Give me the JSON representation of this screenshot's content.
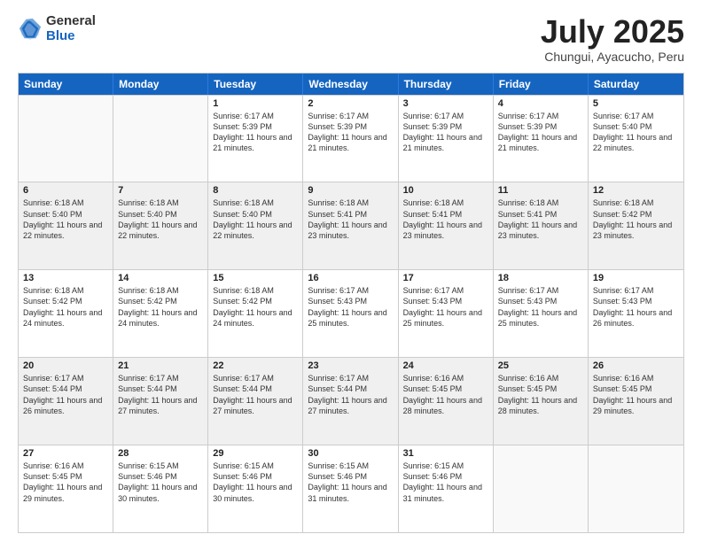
{
  "header": {
    "logo_general": "General",
    "logo_blue": "Blue",
    "month": "July 2025",
    "location": "Chungui, Ayacucho, Peru"
  },
  "days_of_week": [
    "Sunday",
    "Monday",
    "Tuesday",
    "Wednesday",
    "Thursday",
    "Friday",
    "Saturday"
  ],
  "weeks": [
    [
      {
        "day": "",
        "sunrise": "",
        "sunset": "",
        "daylight": "",
        "empty": true
      },
      {
        "day": "",
        "sunrise": "",
        "sunset": "",
        "daylight": "",
        "empty": true
      },
      {
        "day": "1",
        "sunrise": "Sunrise: 6:17 AM",
        "sunset": "Sunset: 5:39 PM",
        "daylight": "Daylight: 11 hours and 21 minutes.",
        "empty": false
      },
      {
        "day": "2",
        "sunrise": "Sunrise: 6:17 AM",
        "sunset": "Sunset: 5:39 PM",
        "daylight": "Daylight: 11 hours and 21 minutes.",
        "empty": false
      },
      {
        "day": "3",
        "sunrise": "Sunrise: 6:17 AM",
        "sunset": "Sunset: 5:39 PM",
        "daylight": "Daylight: 11 hours and 21 minutes.",
        "empty": false
      },
      {
        "day": "4",
        "sunrise": "Sunrise: 6:17 AM",
        "sunset": "Sunset: 5:39 PM",
        "daylight": "Daylight: 11 hours and 21 minutes.",
        "empty": false
      },
      {
        "day": "5",
        "sunrise": "Sunrise: 6:17 AM",
        "sunset": "Sunset: 5:40 PM",
        "daylight": "Daylight: 11 hours and 22 minutes.",
        "empty": false
      }
    ],
    [
      {
        "day": "6",
        "sunrise": "Sunrise: 6:18 AM",
        "sunset": "Sunset: 5:40 PM",
        "daylight": "Daylight: 11 hours and 22 minutes.",
        "empty": false
      },
      {
        "day": "7",
        "sunrise": "Sunrise: 6:18 AM",
        "sunset": "Sunset: 5:40 PM",
        "daylight": "Daylight: 11 hours and 22 minutes.",
        "empty": false
      },
      {
        "day": "8",
        "sunrise": "Sunrise: 6:18 AM",
        "sunset": "Sunset: 5:40 PM",
        "daylight": "Daylight: 11 hours and 22 minutes.",
        "empty": false
      },
      {
        "day": "9",
        "sunrise": "Sunrise: 6:18 AM",
        "sunset": "Sunset: 5:41 PM",
        "daylight": "Daylight: 11 hours and 23 minutes.",
        "empty": false
      },
      {
        "day": "10",
        "sunrise": "Sunrise: 6:18 AM",
        "sunset": "Sunset: 5:41 PM",
        "daylight": "Daylight: 11 hours and 23 minutes.",
        "empty": false
      },
      {
        "day": "11",
        "sunrise": "Sunrise: 6:18 AM",
        "sunset": "Sunset: 5:41 PM",
        "daylight": "Daylight: 11 hours and 23 minutes.",
        "empty": false
      },
      {
        "day": "12",
        "sunrise": "Sunrise: 6:18 AM",
        "sunset": "Sunset: 5:42 PM",
        "daylight": "Daylight: 11 hours and 23 minutes.",
        "empty": false
      }
    ],
    [
      {
        "day": "13",
        "sunrise": "Sunrise: 6:18 AM",
        "sunset": "Sunset: 5:42 PM",
        "daylight": "Daylight: 11 hours and 24 minutes.",
        "empty": false
      },
      {
        "day": "14",
        "sunrise": "Sunrise: 6:18 AM",
        "sunset": "Sunset: 5:42 PM",
        "daylight": "Daylight: 11 hours and 24 minutes.",
        "empty": false
      },
      {
        "day": "15",
        "sunrise": "Sunrise: 6:18 AM",
        "sunset": "Sunset: 5:42 PM",
        "daylight": "Daylight: 11 hours and 24 minutes.",
        "empty": false
      },
      {
        "day": "16",
        "sunrise": "Sunrise: 6:17 AM",
        "sunset": "Sunset: 5:43 PM",
        "daylight": "Daylight: 11 hours and 25 minutes.",
        "empty": false
      },
      {
        "day": "17",
        "sunrise": "Sunrise: 6:17 AM",
        "sunset": "Sunset: 5:43 PM",
        "daylight": "Daylight: 11 hours and 25 minutes.",
        "empty": false
      },
      {
        "day": "18",
        "sunrise": "Sunrise: 6:17 AM",
        "sunset": "Sunset: 5:43 PM",
        "daylight": "Daylight: 11 hours and 25 minutes.",
        "empty": false
      },
      {
        "day": "19",
        "sunrise": "Sunrise: 6:17 AM",
        "sunset": "Sunset: 5:43 PM",
        "daylight": "Daylight: 11 hours and 26 minutes.",
        "empty": false
      }
    ],
    [
      {
        "day": "20",
        "sunrise": "Sunrise: 6:17 AM",
        "sunset": "Sunset: 5:44 PM",
        "daylight": "Daylight: 11 hours and 26 minutes.",
        "empty": false
      },
      {
        "day": "21",
        "sunrise": "Sunrise: 6:17 AM",
        "sunset": "Sunset: 5:44 PM",
        "daylight": "Daylight: 11 hours and 27 minutes.",
        "empty": false
      },
      {
        "day": "22",
        "sunrise": "Sunrise: 6:17 AM",
        "sunset": "Sunset: 5:44 PM",
        "daylight": "Daylight: 11 hours and 27 minutes.",
        "empty": false
      },
      {
        "day": "23",
        "sunrise": "Sunrise: 6:17 AM",
        "sunset": "Sunset: 5:44 PM",
        "daylight": "Daylight: 11 hours and 27 minutes.",
        "empty": false
      },
      {
        "day": "24",
        "sunrise": "Sunrise: 6:16 AM",
        "sunset": "Sunset: 5:45 PM",
        "daylight": "Daylight: 11 hours and 28 minutes.",
        "empty": false
      },
      {
        "day": "25",
        "sunrise": "Sunrise: 6:16 AM",
        "sunset": "Sunset: 5:45 PM",
        "daylight": "Daylight: 11 hours and 28 minutes.",
        "empty": false
      },
      {
        "day": "26",
        "sunrise": "Sunrise: 6:16 AM",
        "sunset": "Sunset: 5:45 PM",
        "daylight": "Daylight: 11 hours and 29 minutes.",
        "empty": false
      }
    ],
    [
      {
        "day": "27",
        "sunrise": "Sunrise: 6:16 AM",
        "sunset": "Sunset: 5:45 PM",
        "daylight": "Daylight: 11 hours and 29 minutes.",
        "empty": false
      },
      {
        "day": "28",
        "sunrise": "Sunrise: 6:15 AM",
        "sunset": "Sunset: 5:46 PM",
        "daylight": "Daylight: 11 hours and 30 minutes.",
        "empty": false
      },
      {
        "day": "29",
        "sunrise": "Sunrise: 6:15 AM",
        "sunset": "Sunset: 5:46 PM",
        "daylight": "Daylight: 11 hours and 30 minutes.",
        "empty": false
      },
      {
        "day": "30",
        "sunrise": "Sunrise: 6:15 AM",
        "sunset": "Sunset: 5:46 PM",
        "daylight": "Daylight: 11 hours and 31 minutes.",
        "empty": false
      },
      {
        "day": "31",
        "sunrise": "Sunrise: 6:15 AM",
        "sunset": "Sunset: 5:46 PM",
        "daylight": "Daylight: 11 hours and 31 minutes.",
        "empty": false
      },
      {
        "day": "",
        "sunrise": "",
        "sunset": "",
        "daylight": "",
        "empty": true
      },
      {
        "day": "",
        "sunrise": "",
        "sunset": "",
        "daylight": "",
        "empty": true
      }
    ]
  ]
}
